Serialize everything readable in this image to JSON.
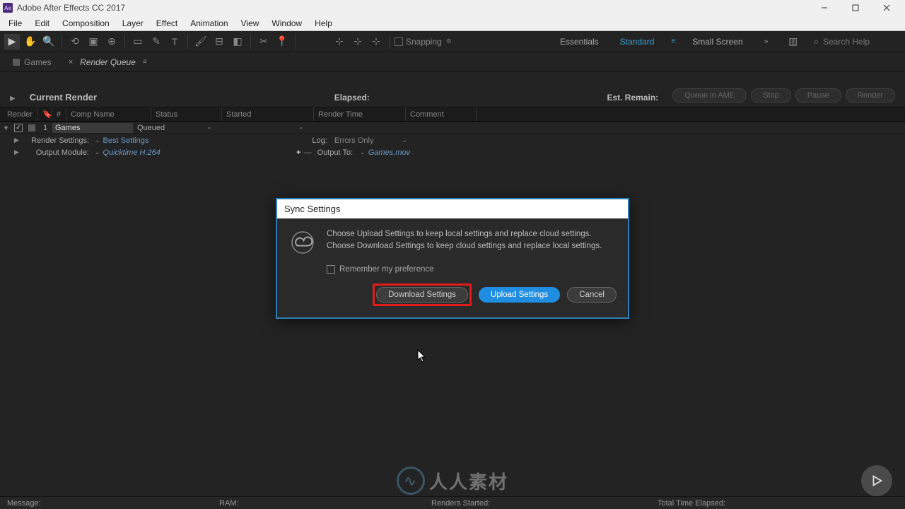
{
  "title": "Adobe After Effects CC 2017",
  "logo_text": "Ae",
  "menu": [
    "File",
    "Edit",
    "Composition",
    "Layer",
    "Effect",
    "Animation",
    "View",
    "Window",
    "Help"
  ],
  "snapping": "Snapping",
  "workspaces": {
    "items": [
      "Essentials",
      "Standard",
      "Small Screen"
    ],
    "active": "Standard"
  },
  "search_placeholder": "Search Help",
  "tabs": {
    "comp": "Games",
    "queue": "Render Queue"
  },
  "render_header": {
    "current": "Current Render",
    "elapsed": "Elapsed:",
    "remain": "Est. Remain:",
    "buttons": [
      "Queue in AME",
      "Stop",
      "Pause",
      "Render"
    ]
  },
  "queue_cols": [
    "Render",
    "#",
    "Comp Name",
    "Status",
    "Started",
    "Render Time",
    "Comment"
  ],
  "queue_row": {
    "num": "1",
    "comp": "Games",
    "status": "Queued",
    "started": "-",
    "rtime": "-",
    "render_settings_lbl": "Render Settings:",
    "render_settings_val": "Best Settings",
    "output_module_lbl": "Output Module:",
    "output_module_val": "Quicktime H.264",
    "log_lbl": "Log:",
    "log_val": "Errors Only",
    "output_to_lbl": "Output To:",
    "output_to_val": "Games.mov"
  },
  "dialog": {
    "title": "Sync Settings",
    "line1": "Choose Upload Settings to keep local settings and replace cloud settings.",
    "line2": "Choose Download Settings to keep cloud settings and replace local settings.",
    "checkbox": "Remember my preference",
    "download": "Download Settings",
    "upload": "Upload Settings",
    "cancel": "Cancel"
  },
  "statusbar": {
    "message": "Message:",
    "ram": "RAM:",
    "renders_started": "Renders Started:",
    "total_time": "Total Time Elapsed:"
  },
  "watermark": "人人素材"
}
